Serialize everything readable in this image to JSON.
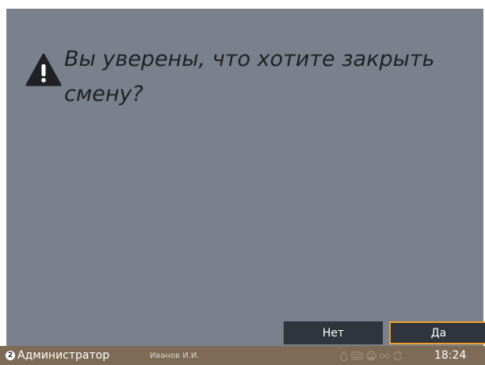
{
  "dialog": {
    "prompt": "Вы уверены, что хотите закрыть смену?",
    "no_label": "Нет",
    "yes_label": "Да"
  },
  "statusbar": {
    "role_number": "2",
    "role": "Администратор",
    "user": "Иванов И.И.",
    "time": "18:24"
  },
  "colors": {
    "panel_background": "#7a818c",
    "button_background": "#2f343d",
    "focused_button_border": "#f0a028",
    "statusbar_background": "#7e6b57"
  },
  "icons": {
    "dialog": "warning-icon",
    "statusbar": [
      "water-drop-icon",
      "keyboard-icon",
      "printer-icon",
      "link-icon",
      "sync-icon"
    ]
  }
}
